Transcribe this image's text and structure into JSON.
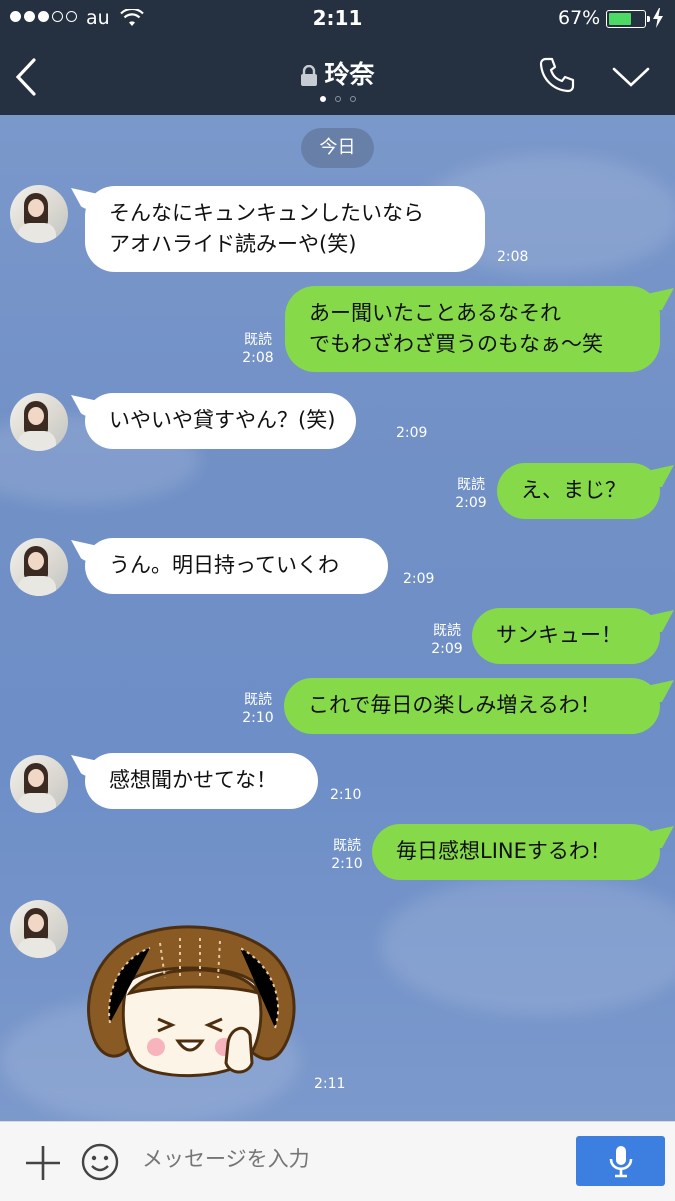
{
  "status_bar": {
    "carrier": "au",
    "time": "2:11",
    "battery": "67%",
    "battery_level": 0.67,
    "signal_bars": 3
  },
  "header": {
    "title": "玲奈",
    "page_indicator": {
      "count": 3,
      "active": 1
    }
  },
  "chat": {
    "date_label": "今日",
    "messages": [
      {
        "side": "in",
        "text": "そんなにキュンキュンしたいなら\nアオハライド読みーや(笑)",
        "time": "2:08"
      },
      {
        "side": "out",
        "text": "あー聞いたことあるなそれ\nでもわざわざ買うのもなぁ〜笑",
        "read": "既読",
        "time": "2:08"
      },
      {
        "side": "in",
        "text": "いやいや貸すやん？(笑)",
        "time": "2:09"
      },
      {
        "side": "out",
        "text": "え、まじ？",
        "read": "既読",
        "time": "2:09"
      },
      {
        "side": "in",
        "text": "うん。明日持っていくわ",
        "time": "2:09"
      },
      {
        "side": "out",
        "text": "サンキュー！",
        "read": "既読",
        "time": "2:09"
      },
      {
        "side": "out",
        "text": "これで毎日の楽しみ増えるわ！",
        "read": "既読",
        "time": "2:10"
      },
      {
        "side": "in",
        "text": "感想聞かせてな！",
        "time": "2:10"
      },
      {
        "side": "out",
        "text": "毎日感想LINEするわ！",
        "read": "既読",
        "time": "2:10"
      },
      {
        "side": "in",
        "type": "sticker",
        "time": "2:11"
      }
    ]
  },
  "input_bar": {
    "placeholder": "メッセージを入力"
  },
  "icons": {
    "back": "chevron-left-icon",
    "lock": "lock-icon",
    "call": "phone-icon",
    "menu": "chevron-down-icon",
    "add": "plus-icon",
    "emoji": "smile-icon",
    "voice": "microphone-icon"
  },
  "colors": {
    "header_bg": "#253040",
    "chat_bg": "#7a98c9",
    "incoming_bubble": "#ffffff",
    "outgoing_bubble": "#86d949",
    "mic_button": "#3d7fe0"
  }
}
